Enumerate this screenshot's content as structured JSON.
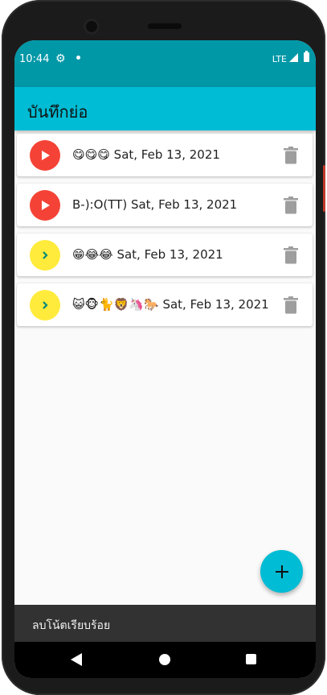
{
  "status_bar": {
    "time": "10:44",
    "network": "LTE",
    "icons": [
      "gear-icon",
      "notification-dot-icon",
      "signal-icon",
      "battery-icon"
    ]
  },
  "app_bar": {
    "title": "บันทึกย่อ"
  },
  "notes": [
    {
      "text": "😋😋😋 Sat, Feb 13, 2021",
      "action_icon": "play-icon",
      "action_color": "#f44336"
    },
    {
      "text": "B-):O(TT) Sat, Feb 13, 2021",
      "action_icon": "play-icon",
      "action_color": "#f44336"
    },
    {
      "text": "😁😂😂 Sat, Feb 13, 2021",
      "action_icon": "chevron-right-icon",
      "action_color": "#ffeb3b"
    },
    {
      "text": "😺🐵🐈🦁🦄🐎 Sat, Feb 13, 2021",
      "action_icon": "chevron-right-icon",
      "action_color": "#ffeb3b"
    }
  ],
  "fab": {
    "icon": "plus-icon"
  },
  "snackbar": {
    "message": "ลบโน้ตเรียบร้อย"
  },
  "colors": {
    "primary": "#00bcd4",
    "primary_dark": "#0097a7",
    "play": "#f44336",
    "open": "#ffeb3b",
    "delete_icon": "#9e9e9e"
  }
}
